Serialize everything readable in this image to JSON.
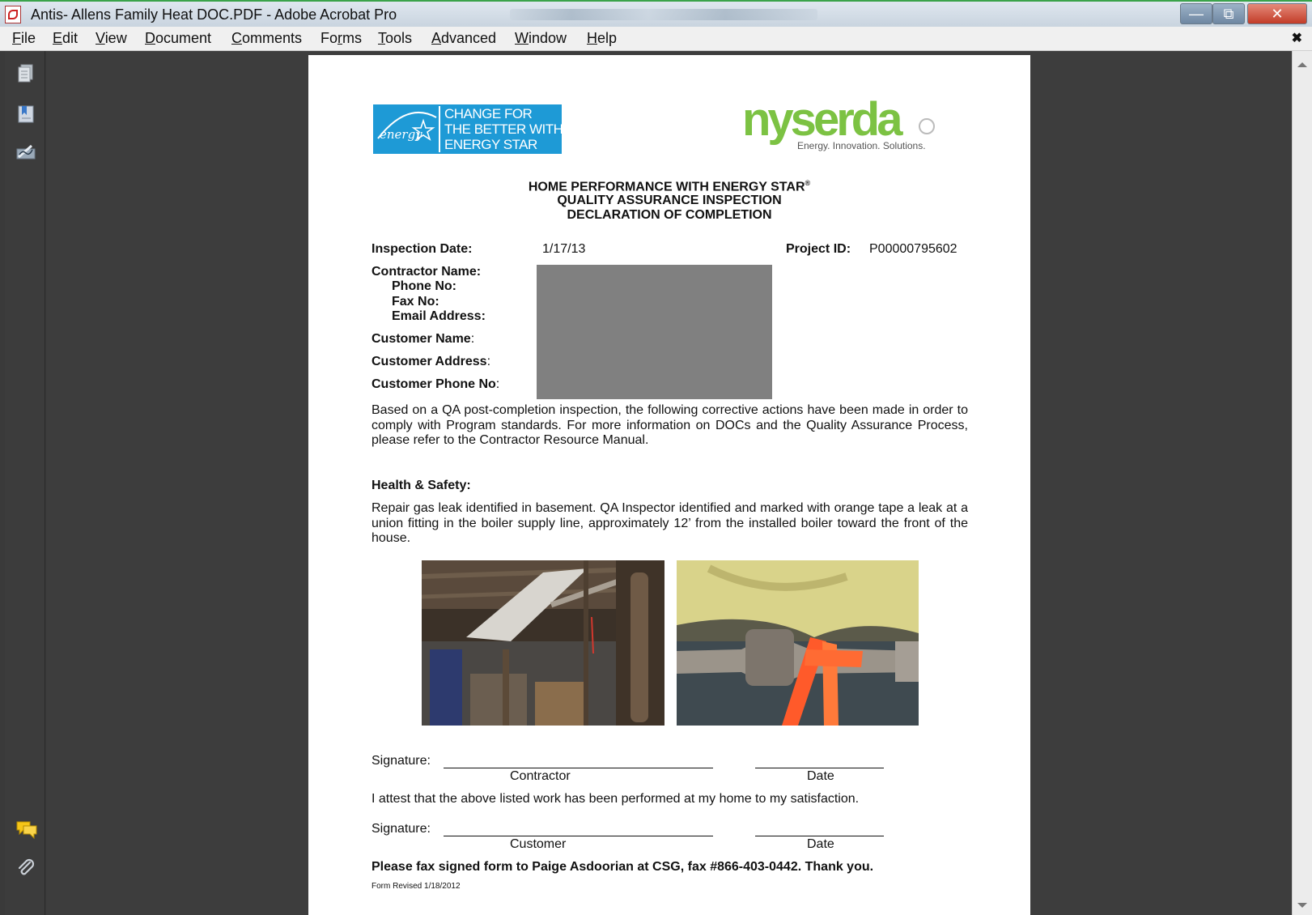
{
  "window": {
    "title": "Antis- Allens Family Heat DOC.PDF - Adobe Acrobat Pro",
    "minimize_glyph": "—",
    "maximize_glyph": "⧉",
    "close_glyph": "✕"
  },
  "menubar": {
    "items": [
      {
        "u": "F",
        "rest": "ile"
      },
      {
        "u": "E",
        "rest": "dit"
      },
      {
        "u": "V",
        "rest": "iew"
      },
      {
        "u": "D",
        "rest": "ocument"
      },
      {
        "u": "C",
        "rest": "omments"
      },
      {
        "pre": "Fo",
        "u": "r",
        "rest": "ms"
      },
      {
        "u": "T",
        "rest": "ools"
      },
      {
        "u": "A",
        "rest": "dvanced"
      },
      {
        "u": "W",
        "rest": "indow"
      },
      {
        "u": "H",
        "rest": "elp"
      }
    ],
    "close_glyph": "✖"
  },
  "sidebar": {
    "icons": [
      "pages-icon",
      "bookmarks-icon",
      "signatures-icon",
      "comments-icon",
      "attachments-icon"
    ]
  },
  "document": {
    "energy_star_logo": {
      "script": "energy",
      "lines": [
        "CHANGE FOR",
        "THE BETTER WITH",
        "ENERGY STAR"
      ]
    },
    "nyserda_logo": {
      "wordmark": "nyserda",
      "tagline": "Energy. Innovation. Solutions."
    },
    "title_lines": [
      "HOME PERFORMANCE WITH ENERGY STAR",
      "QUALITY ASSURANCE INSPECTION",
      "DECLARATION OF COMPLETION"
    ],
    "title_reg": "®",
    "inspection_date_label": "Inspection Date:",
    "inspection_date": "1/17/13",
    "project_id_label": "Project ID:",
    "project_id": "P00000795602",
    "contractor_name_label": "Contractor Name:",
    "phone_label": "Phone No:",
    "fax_label": "Fax No:",
    "email_label": "Email Address:",
    "customer_name_label": "Customer Name",
    "customer_address_label": "Customer Address",
    "customer_phone_label": "Customer Phone No",
    "label_colon": ":",
    "intro_paragraph": "Based on a QA post-completion inspection, the following corrective actions have been made in order to comply with Program standards. For more information on DOCs and the Quality Assurance Process, please refer to the Contractor Resource Manual.",
    "health_safety_heading": "Health & Safety:",
    "health_safety_text": "Repair gas leak identified in basement.  QA Inspector identified and marked with orange tape a leak at a union fitting in the boiler supply line, approximately 12’ from the installed boiler toward the front of the house.",
    "signature_label": "Signature:",
    "contractor_caption": "Contractor",
    "date_caption": "Date",
    "attest_text": "I attest that the above listed work has been performed at my home to my satisfaction.",
    "customer_caption": "Customer",
    "fax_instruction": "Please fax signed form to Paige Asdoorian at CSG, fax #866-403-0442.  Thank you.",
    "form_revised": "Form Revised 1/18/2012"
  },
  "colors": {
    "energy_star_blue": "#1e9ad6",
    "nyserda_green": "#7cc243",
    "nyserda_gray": "#7a7a7a",
    "redaction_gray": "#808080",
    "titlebar_accent": "#3aa34a"
  }
}
